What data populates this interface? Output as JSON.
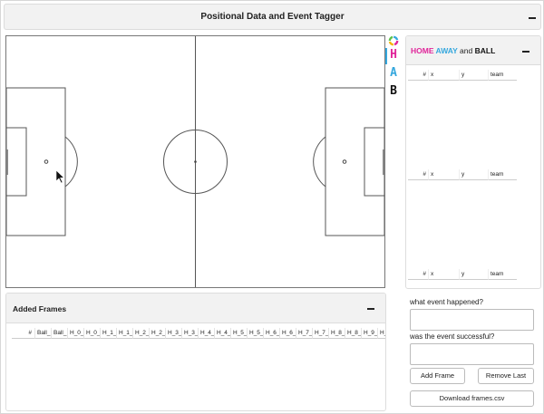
{
  "app": {
    "title": "Positional Data and Event Tagger"
  },
  "tagbar": {
    "logo": "color-wheel-logo",
    "tags": [
      "H",
      "A",
      "B"
    ],
    "colors": {
      "home": "#e0259a",
      "away": "#34a7dd",
      "ball": "#111111"
    }
  },
  "side_panel": {
    "header": {
      "home": "HOME",
      "away": "AWAY",
      "and": "and",
      "ball": "BALL"
    },
    "tables": [
      {
        "columns": [
          "#",
          "x",
          "y",
          "team"
        ]
      },
      {
        "columns": [
          "#",
          "x",
          "y",
          "team"
        ]
      },
      {
        "columns": [
          "#",
          "x",
          "y",
          "team"
        ]
      }
    ]
  },
  "frames_panel": {
    "title": "Added Frames",
    "columns": [
      "#",
      "Ball_",
      "Ball_",
      "H_0_",
      "H_0_",
      "H_1_",
      "H_1_",
      "H_2_",
      "H_2_",
      "H_3_",
      "H_3_",
      "H_4_",
      "H_4_",
      "H_5_",
      "H_5_",
      "H_6_",
      "H_6_",
      "H_7_",
      "H_7_",
      "H_8_",
      "H_8_",
      "H_9_",
      "H_"
    ]
  },
  "form": {
    "event_question": "what event happened?",
    "event_value": "",
    "success_question": "was the event successful?",
    "success_value": "",
    "add_frame_label": "Add Frame",
    "remove_last_label": "Remove Last",
    "download_label": "Download frames.csv"
  }
}
